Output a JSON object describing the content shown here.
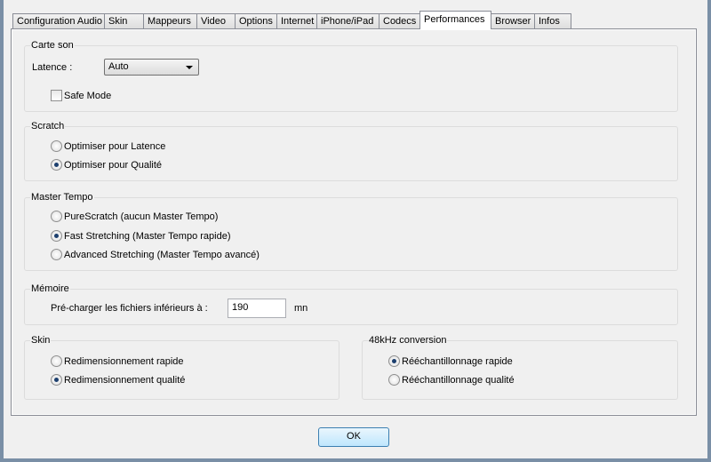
{
  "tabs": [
    "Configuration Audio",
    "Skin",
    "Mappeurs",
    "Video",
    "Options",
    "Internet",
    "iPhone/iPad",
    "Codecs",
    "Performances",
    "Browser",
    "Infos"
  ],
  "selected_tab": "Performances",
  "carte_son": {
    "title": "Carte son",
    "latence_label": "Latence :",
    "latence_value": "Auto",
    "safe_mode_label": "Safe Mode",
    "safe_mode_checked": false
  },
  "scratch": {
    "title": "Scratch",
    "options": [
      "Optimiser pour Latence",
      "Optimiser pour Qualité"
    ],
    "selected": 1
  },
  "master_tempo": {
    "title": "Master Tempo",
    "options": [
      "PureScratch (aucun Master Tempo)",
      "Fast Stretching (Master Tempo rapide)",
      "Advanced Stretching (Master Tempo avancé)"
    ],
    "selected": 1
  },
  "memoire": {
    "title": "Mémoire",
    "label": "Pré-charger les fichiers inférieurs à :",
    "value": "190",
    "unit": "mn"
  },
  "skin": {
    "title": "Skin",
    "options": [
      "Redimensionnement rapide",
      "Redimensionnement qualité"
    ],
    "selected": 1
  },
  "conversion": {
    "title": "48kHz conversion",
    "options": [
      "Rééchantillonnage rapide",
      "Rééchantillonnage qualité"
    ],
    "selected": 0
  },
  "ok_label": "OK"
}
